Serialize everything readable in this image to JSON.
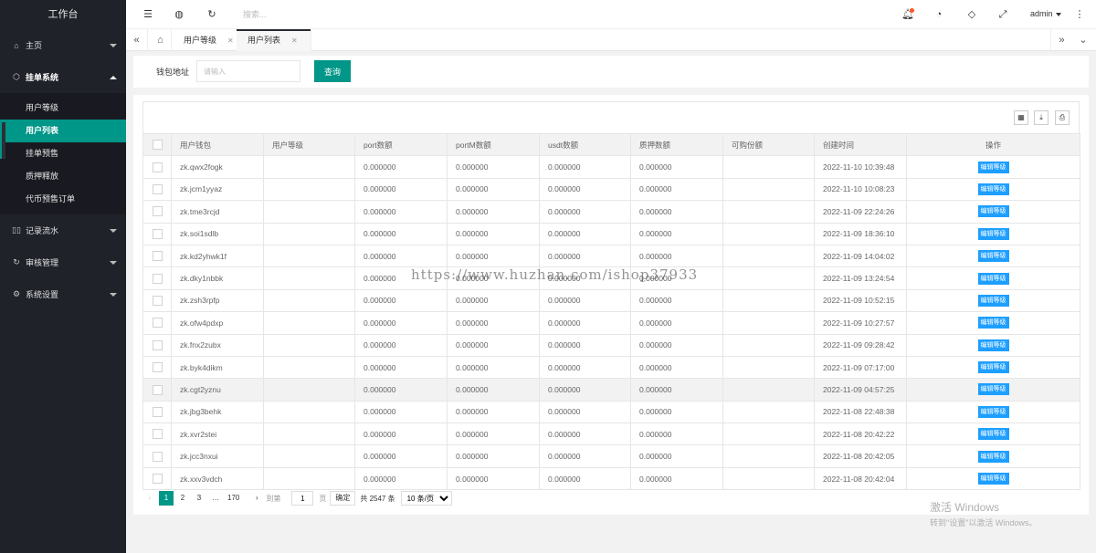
{
  "sidebar": {
    "title": "工作台",
    "items": [
      {
        "label": "主页",
        "icon": "home-icon",
        "caret": "down"
      },
      {
        "label": "挂单系统",
        "icon": "cube-icon",
        "caret": "up",
        "children": [
          {
            "label": "用户等级",
            "active": false
          },
          {
            "label": "用户列表",
            "active": true
          },
          {
            "label": "挂单预售",
            "active": false
          },
          {
            "label": "质押释放",
            "active": false
          },
          {
            "label": "代币预售订单",
            "active": false
          }
        ]
      },
      {
        "label": "记录流水",
        "icon": "columns-icon",
        "caret": "down"
      },
      {
        "label": "审核管理",
        "icon": "refresh-icon",
        "caret": "down"
      },
      {
        "label": "系统设置",
        "icon": "gear-icon",
        "caret": "down"
      }
    ]
  },
  "header": {
    "search_placeholder": "搜索...",
    "user": "admin",
    "icons": [
      "menu-fold-icon",
      "globe-icon",
      "refresh-icon",
      "bell-icon",
      "dashboard-icon",
      "tag-icon",
      "fullscreen-icon",
      "more-vertical-icon"
    ]
  },
  "tabs": {
    "items": [
      {
        "label": "用户等级",
        "active": false
      },
      {
        "label": "用户列表",
        "active": true
      }
    ]
  },
  "filter": {
    "label": "钱包地址",
    "placeholder": "请输入",
    "value": "",
    "button": "查询"
  },
  "table": {
    "columns": [
      "用户钱包",
      "用户等级",
      "port数额",
      "portM数额",
      "usdt数额",
      "质押数额",
      "可购份额",
      "创建时间",
      "操作"
    ],
    "action_label": "编辑等级",
    "rows": [
      {
        "wallet": "zk.qwx2fogk",
        "level": "",
        "port": "0.000000",
        "portM": "0.000000",
        "usdt": "0.000000",
        "pledge": "0.000000",
        "share": "",
        "time": "2022-11-10 10:39:48"
      },
      {
        "wallet": "zk.jcm1yyaz",
        "level": "",
        "port": "0.000000",
        "portM": "0.000000",
        "usdt": "0.000000",
        "pledge": "0.000000",
        "share": "",
        "time": "2022-11-10 10:08:23"
      },
      {
        "wallet": "zk.tme3rcjd",
        "level": "",
        "port": "0.000000",
        "portM": "0.000000",
        "usdt": "0.000000",
        "pledge": "0.000000",
        "share": "",
        "time": "2022-11-09 22:24:26"
      },
      {
        "wallet": "zk.soi1sdlb",
        "level": "",
        "port": "0.000000",
        "portM": "0.000000",
        "usdt": "0.000000",
        "pledge": "0.000000",
        "share": "",
        "time": "2022-11-09 18:36:10"
      },
      {
        "wallet": "zk.kd2yhwk1f",
        "level": "",
        "port": "0.000000",
        "portM": "0.000000",
        "usdt": "0.000000",
        "pledge": "0.000000",
        "share": "",
        "time": "2022-11-09 14:04:02"
      },
      {
        "wallet": "zk.dky1nbbk",
        "level": "",
        "port": "0.000000",
        "portM": "0.000000",
        "usdt": "0.000000",
        "pledge": "0.000000",
        "share": "",
        "time": "2022-11-09 13:24:54"
      },
      {
        "wallet": "zk.zsh3rpfp",
        "level": "",
        "port": "0.000000",
        "portM": "0.000000",
        "usdt": "0.000000",
        "pledge": "0.000000",
        "share": "",
        "time": "2022-11-09 10:52:15"
      },
      {
        "wallet": "zk.ofw4pdxp",
        "level": "",
        "port": "0.000000",
        "portM": "0.000000",
        "usdt": "0.000000",
        "pledge": "0.000000",
        "share": "",
        "time": "2022-11-09 10:27:57"
      },
      {
        "wallet": "zk.fnx2zubx",
        "level": "",
        "port": "0.000000",
        "portM": "0.000000",
        "usdt": "0.000000",
        "pledge": "0.000000",
        "share": "",
        "time": "2022-11-09 09:28:42"
      },
      {
        "wallet": "zk.byk4dikm",
        "level": "",
        "port": "0.000000",
        "portM": "0.000000",
        "usdt": "0.000000",
        "pledge": "0.000000",
        "share": "",
        "time": "2022-11-09 07:17:00"
      },
      {
        "wallet": "zk.cgt2yznu",
        "level": "",
        "port": "0.000000",
        "portM": "0.000000",
        "usdt": "0.000000",
        "pledge": "0.000000",
        "share": "",
        "time": "2022-11-09 04:57:25",
        "highlight": true
      },
      {
        "wallet": "zk.jbg3behk",
        "level": "",
        "port": "0.000000",
        "portM": "0.000000",
        "usdt": "0.000000",
        "pledge": "0.000000",
        "share": "",
        "time": "2022-11-08 22:48:38"
      },
      {
        "wallet": "zk.xvr2stei",
        "level": "",
        "port": "0.000000",
        "portM": "0.000000",
        "usdt": "0.000000",
        "pledge": "0.000000",
        "share": "",
        "time": "2022-11-08 20:42:22"
      },
      {
        "wallet": "zk.jcc3nxui",
        "level": "",
        "port": "0.000000",
        "portM": "0.000000",
        "usdt": "0.000000",
        "pledge": "0.000000",
        "share": "",
        "time": "2022-11-08 20:42:05"
      },
      {
        "wallet": "zk.xxv3vdch",
        "level": "",
        "port": "0.000000",
        "portM": "0.000000",
        "usdt": "0.000000",
        "pledge": "0.000000",
        "share": "",
        "time": "2022-11-08 20:42:04"
      }
    ]
  },
  "pagination": {
    "pages": [
      "1",
      "2",
      "3"
    ],
    "ellipsis": "…",
    "last": "170",
    "goto_label": "到第",
    "goto_value": "1",
    "page_unit": "页",
    "confirm": "确定",
    "total": "共 2547 条",
    "page_size": "10 条/页"
  },
  "watermark": "https://www.huzhan.com/ishop37933",
  "os_overlay": {
    "line1": "激活 Windows",
    "line2": "转到\"设置\"以激活 Windows。"
  },
  "colors": {
    "sidebar_bg": "#20222a",
    "accent": "#009688",
    "action_blue": "#1e9fff"
  }
}
